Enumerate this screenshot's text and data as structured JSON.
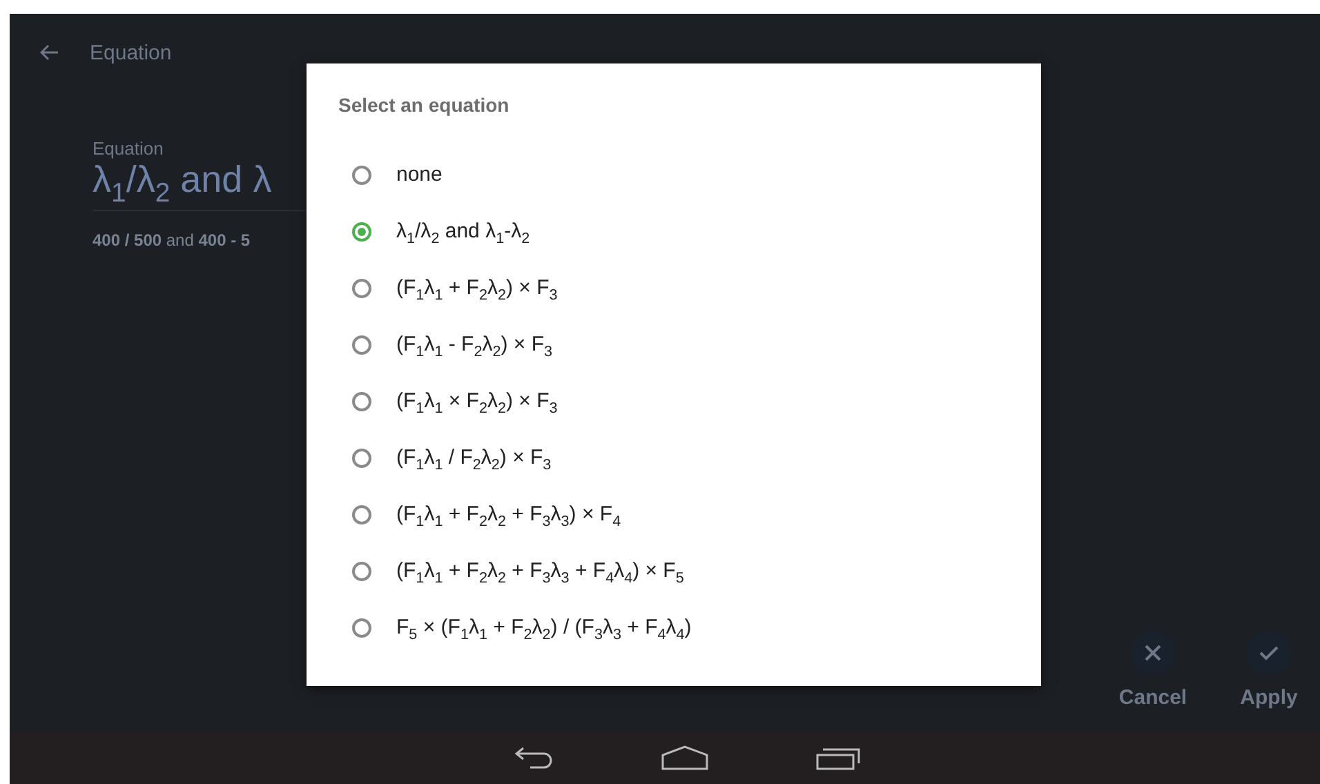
{
  "app_bar": {
    "title": "Equation"
  },
  "field": {
    "label": "Equation",
    "value": "λ$_{1}$/λ$_{2}$ and λ",
    "preview": "**400 / 500** and **400 - 5**"
  },
  "actions": [
    {
      "kind": "cancel",
      "label": "Cancel"
    },
    {
      "kind": "apply",
      "label": "Apply"
    }
  ],
  "dialog": {
    "title": "Select an equation",
    "options": [
      {
        "label": "none",
        "selected": false
      },
      {
        "label": "λ$_{1}$/λ$_{2}$ and λ$_{1}$-λ$_{2}$",
        "selected": true
      },
      {
        "label": "(F$_{1}$λ$_{1}$ + F$_{2}$λ$_{2}$) × F$_{3}$",
        "selected": false
      },
      {
        "label": "(F$_{1}$λ$_{1}$ - F$_{2}$λ$_{2}$) × F$_{3}$",
        "selected": false
      },
      {
        "label": "(F$_{1}$λ$_{1}$ × F$_{2}$λ$_{2}$) × F$_{3}$",
        "selected": false
      },
      {
        "label": "(F$_{1}$λ$_{1}$ / F$_{2}$λ$_{2}$) × F$_{3}$",
        "selected": false
      },
      {
        "label": "(F$_{1}$λ$_{1}$ + F$_{2}$λ$_{2}$ + F$_{3}$λ$_{3}$) × F$_{4}$",
        "selected": false
      },
      {
        "label": "(F$_{1}$λ$_{1}$ + F$_{2}$λ$_{2}$ + F$_{3}$λ$_{3}$ + F$_{4}$λ$_{4}$) × F$_{5}$",
        "selected": false
      },
      {
        "label": "F$_{5}$ × (F$_{1}$λ$_{1}$ + F$_{2}$λ$_{2}$) / (F$_{3}$λ$_{3}$ + F$_{4}$λ$_{4}$)",
        "selected": false
      }
    ]
  }
}
